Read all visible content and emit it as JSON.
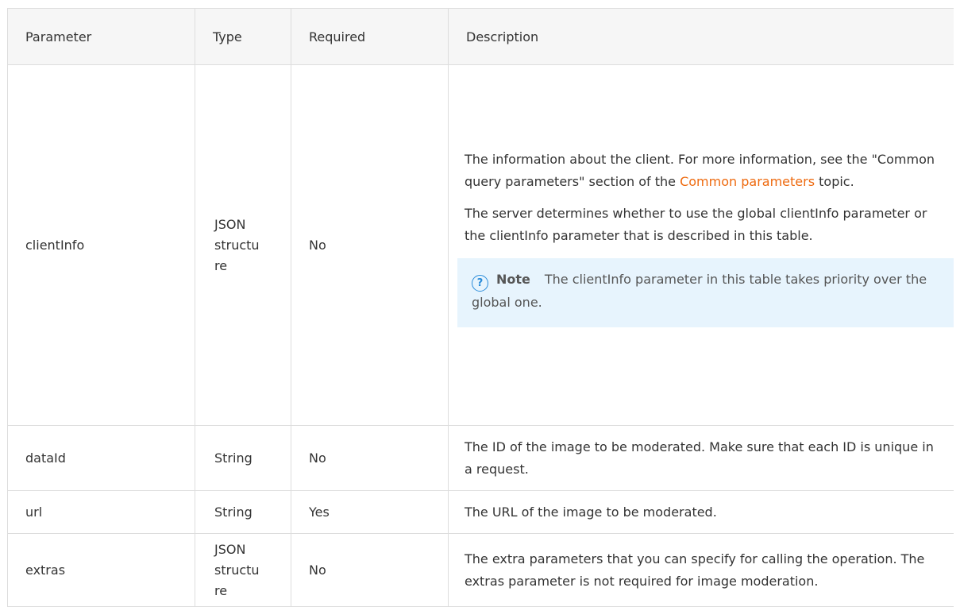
{
  "table": {
    "headers": [
      "Parameter",
      "Type",
      "Required",
      "Description"
    ],
    "rows": [
      {
        "parameter": "clientInfo",
        "type": "JSON structure",
        "type_lines": [
          "JSON",
          "structu",
          "re"
        ],
        "required": "No",
        "desc_p1_before": "The information about the client. For more information, see the \"Common query parameters\" section of the ",
        "desc_p1_link": "Common parameters",
        "desc_p1_after": " topic.",
        "desc_p2": "The server determines whether to use the global clientInfo parameter or the clientInfo parameter that is described in this table.",
        "note_icon": "question-circle-icon",
        "note_label": "Note",
        "note_text": "The clientInfo parameter in this table takes priority over the global one."
      },
      {
        "parameter": "dataId",
        "type": "String",
        "required": "No",
        "description": "The ID of the image to be moderated. Make sure that each ID is unique in a request."
      },
      {
        "parameter": "url",
        "type": "String",
        "required": "Yes",
        "description": "The URL of the image to be moderated."
      },
      {
        "parameter": "extras",
        "type": "JSON structure",
        "type_lines": [
          "JSON",
          "structu",
          "re"
        ],
        "required": "No",
        "description": "The extra parameters that you can specify for calling the operation. The extras parameter is not required for image moderation."
      }
    ]
  },
  "colors": {
    "link": "#ee6a0f",
    "note_bg": "#e7f4fd",
    "note_icon": "#2a8cda",
    "header_bg": "#f6f6f6",
    "border": "#dddddd"
  }
}
